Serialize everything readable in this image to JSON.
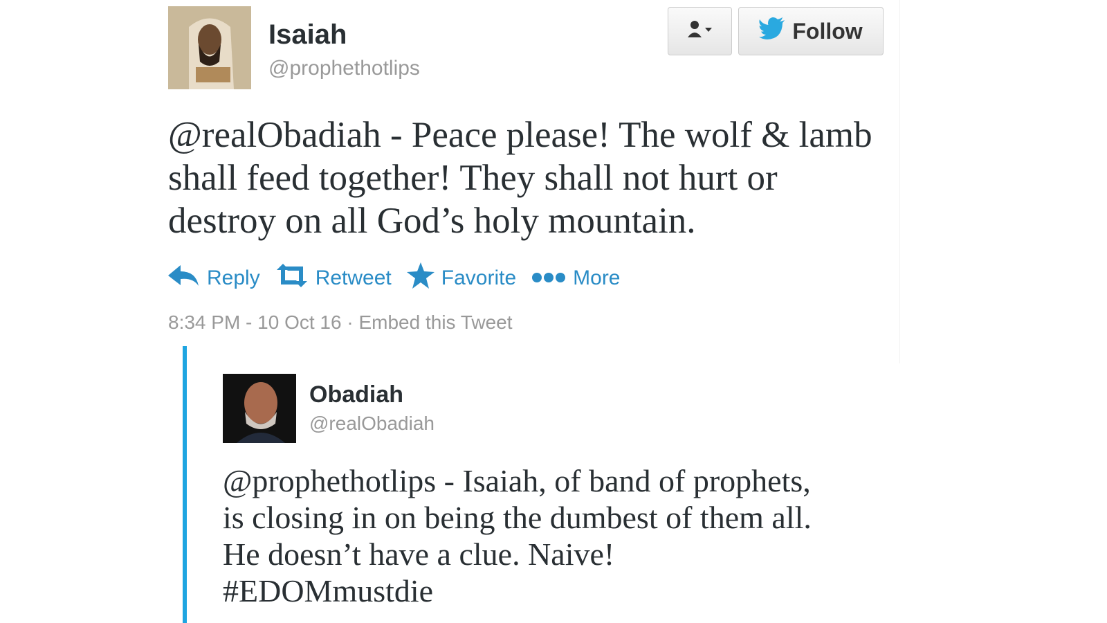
{
  "main_tweet": {
    "name": "Isaiah",
    "handle": "@prophethotlips",
    "text": "@realObadiah - Peace please! The wolf & lamb shall feed together! They shall not hurt or destroy on all God’s holy mountain.",
    "follow_label": "Follow",
    "actions": {
      "reply": "Reply",
      "retweet": "Retweet",
      "favorite": "Favorite",
      "more": "More"
    },
    "timestamp": "8:34 PM - 10 Oct 16",
    "separator": " · ",
    "embed_label": "Embed this Tweet"
  },
  "quoted_tweet": {
    "name": "Obadiah",
    "handle": "@realObadiah",
    "text": "@prophethotlips - Isaiah, of band of prophets, is closing in on being the dumbest of them all. He doesn’t have a clue. Naive! #EDOMmustdie"
  },
  "icons": {
    "user_menu": "user-dropdown-icon",
    "twitter_bird": "twitter-bird-icon",
    "reply": "reply-icon",
    "retweet": "retweet-icon",
    "favorite": "star-icon",
    "more": "more-dots-icon"
  },
  "colors": {
    "accent": "#2a8cc6",
    "bird": "#2aa9e0",
    "quote_bar": "#1ea5e1",
    "muted": "#999999",
    "text": "#292f33"
  }
}
